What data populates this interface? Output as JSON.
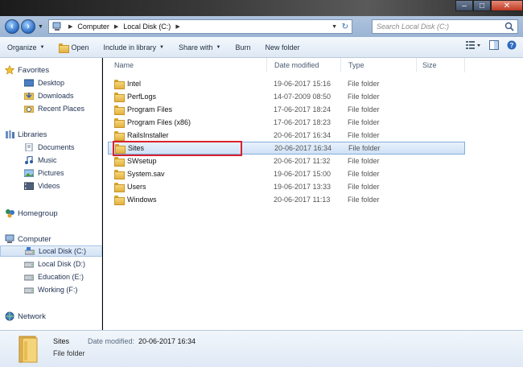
{
  "window": {
    "controls": {
      "minimize": "–",
      "maximize": "□",
      "close": "✕"
    }
  },
  "address": {
    "crumbs": [
      "Computer",
      "Local Disk (C:)"
    ],
    "search_placeholder": "Search Local Disk (C:)"
  },
  "toolbar": {
    "organize": "Organize",
    "open": "Open",
    "include": "Include in library",
    "share": "Share with",
    "burn": "Burn",
    "new_folder": "New folder"
  },
  "nav": {
    "favorites": "Favorites",
    "desktop": "Desktop",
    "downloads": "Downloads",
    "recent": "Recent Places",
    "libraries": "Libraries",
    "documents": "Documents",
    "music": "Music",
    "pictures": "Pictures",
    "videos": "Videos",
    "homegroup": "Homegroup",
    "computer": "Computer",
    "disk_c": "Local Disk (C:)",
    "disk_d": "Local Disk (D:)",
    "disk_e": "Education (E:)",
    "disk_f": "Working (F:)",
    "network": "Network"
  },
  "columns": {
    "name": "Name",
    "date": "Date modified",
    "type": "Type",
    "size": "Size"
  },
  "files": [
    {
      "name": "Intel",
      "date": "19-06-2017 15:16",
      "type": "File folder"
    },
    {
      "name": "PerfLogs",
      "date": "14-07-2009 08:50",
      "type": "File folder"
    },
    {
      "name": "Program Files",
      "date": "17-06-2017 18:24",
      "type": "File folder"
    },
    {
      "name": "Program Files (x86)",
      "date": "17-06-2017 18:23",
      "type": "File folder"
    },
    {
      "name": "RailsInstaller",
      "date": "20-06-2017 16:34",
      "type": "File folder"
    },
    {
      "name": "Sites",
      "date": "20-06-2017 16:34",
      "type": "File folder"
    },
    {
      "name": "SWsetup",
      "date": "20-06-2017 11:32",
      "type": "File folder"
    },
    {
      "name": "System.sav",
      "date": "19-06-2017 15:00",
      "type": "File folder"
    },
    {
      "name": "Users",
      "date": "19-06-2017 13:33",
      "type": "File folder"
    },
    {
      "name": "Windows",
      "date": "20-06-2017 11:13",
      "type": "File folder"
    }
  ],
  "details": {
    "name": "Sites",
    "type": "File folder",
    "date_label": "Date modified:",
    "date_value": "20-06-2017 16:34"
  }
}
